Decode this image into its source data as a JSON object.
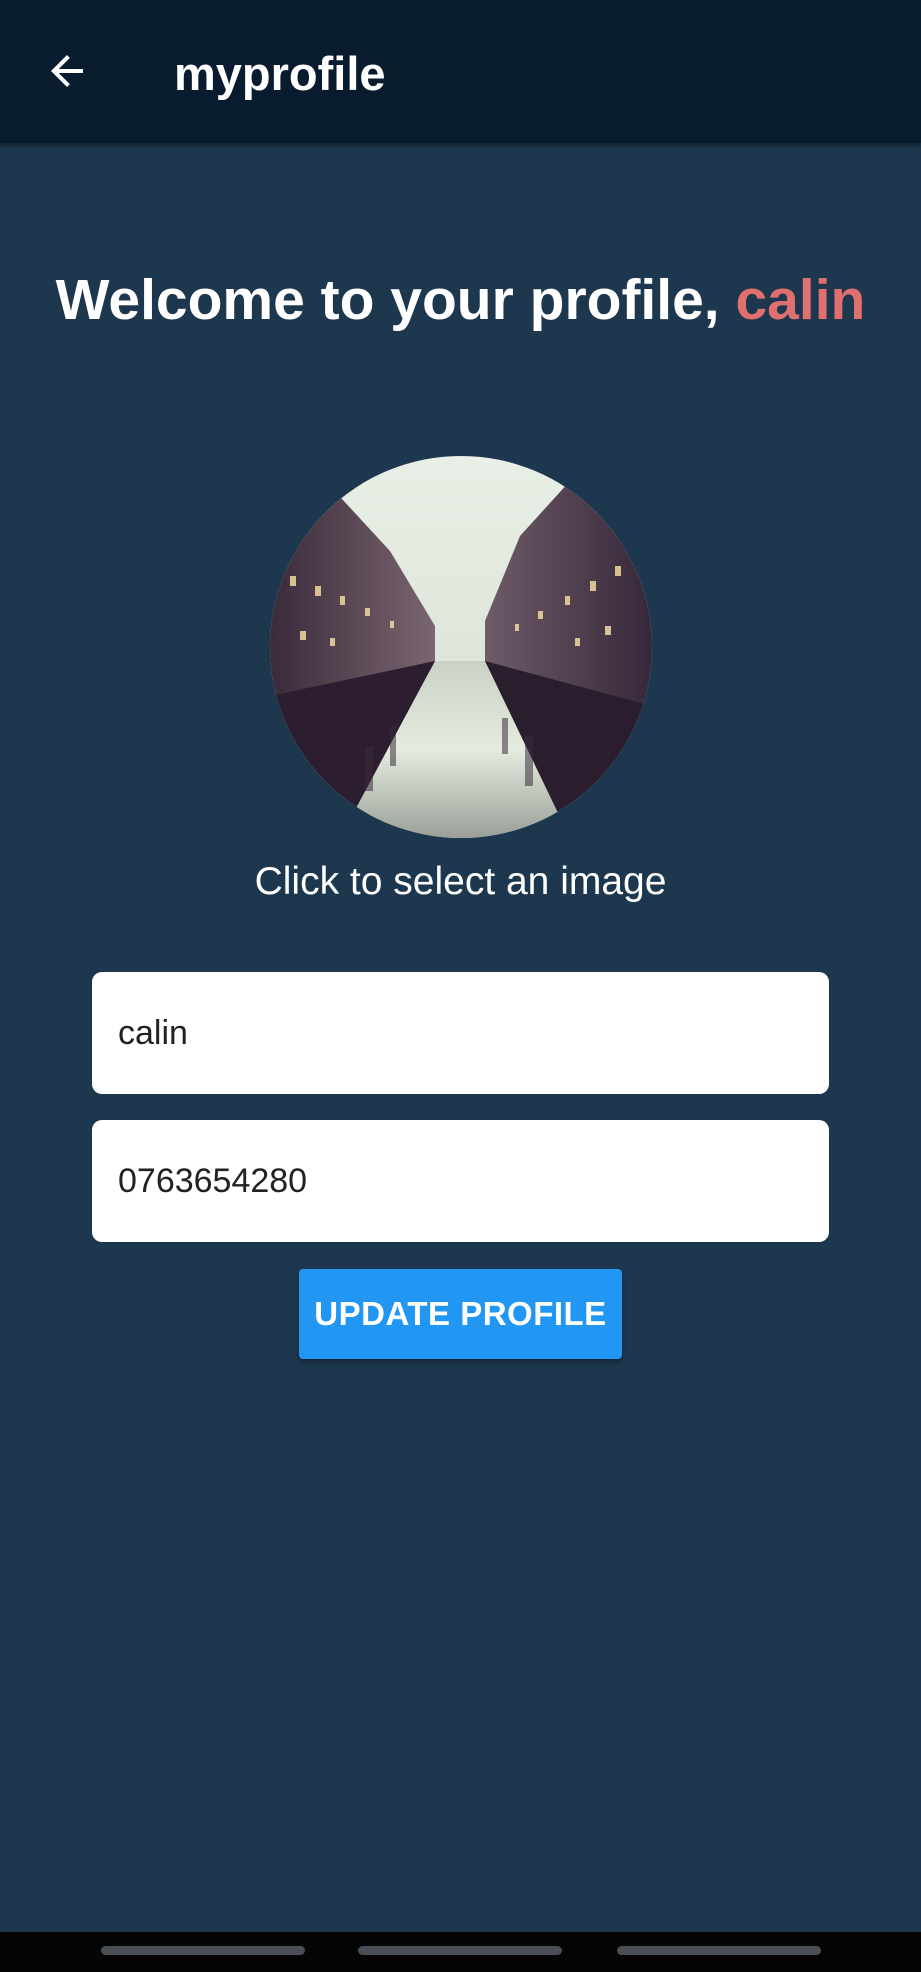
{
  "appbar": {
    "title": "myprofile",
    "back_icon": "arrow-left-icon"
  },
  "welcome": {
    "prefix": "Welcome to your profile, ",
    "username": "calin"
  },
  "avatar": {
    "caption": "Click to select an image"
  },
  "form": {
    "name_value": "calin",
    "phone_value": "0763654280",
    "update_label": "UPDATE PROFILE"
  },
  "colors": {
    "background": "#1d374e",
    "appbar": "#091c2f",
    "accent_name": "#e07070",
    "button": "#2196f3"
  }
}
